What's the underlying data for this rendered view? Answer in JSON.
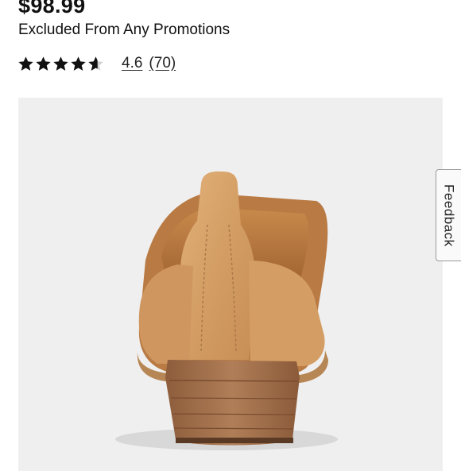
{
  "product": {
    "price": "$98.99",
    "promo_note": "Excluded From Any Promotions"
  },
  "rating": {
    "value": "4.6",
    "count": "(70)",
    "stars_filled": 4.6,
    "stars_total": 5
  },
  "feedback": {
    "label": "Feedback"
  },
  "colors": {
    "star": "#111111",
    "image_bg": "#efefef",
    "shoe_leather": "#d9a46a",
    "heel_wood": "#a87652"
  },
  "icons": {
    "star": "star-icon"
  }
}
